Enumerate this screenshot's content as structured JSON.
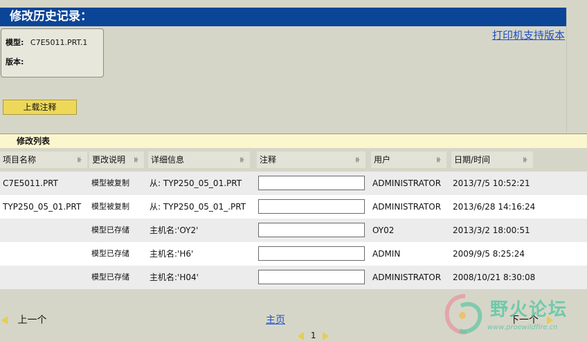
{
  "page_title": "修改历史记录：",
  "print_link": "打印机支持版本",
  "info": {
    "model_label": "模型:",
    "model_value": "C7E5011.PRT.1",
    "version_label": "版本:",
    "version_value": ""
  },
  "upload_button": "上载注释",
  "section_title": "修改列表",
  "columns": [
    "项目名称",
    "更改说明",
    "详细信息",
    "注释",
    "用户",
    "日期/时间"
  ],
  "rows": [
    {
      "name": "C7E5011.PRT",
      "change": "模型被复制",
      "detail": "从: TYP250_05_01.PRT",
      "note": "",
      "user": "ADMINISTRATOR",
      "datetime": "2013/7/5 10:52:21"
    },
    {
      "name": "TYP250_05_01.PRT",
      "change": "模型被复制",
      "detail": "从: TYP250_05_01_.PRT",
      "note": "",
      "user": "ADMINISTRATOR",
      "datetime": "2013/6/28 14:16:24"
    },
    {
      "name": "",
      "change": "模型已存储",
      "detail": "主机名:'OY2'",
      "note": "",
      "user": "OY02",
      "datetime": "2013/3/2 18:00:51"
    },
    {
      "name": "",
      "change": "模型已存储",
      "detail": "主机名:'H6'",
      "note": "",
      "user": "ADMIN",
      "datetime": "2009/9/5 8:25:24"
    },
    {
      "name": "",
      "change": "模型已存储",
      "detail": "主机名:'H04'",
      "note": "",
      "user": "ADMINISTRATOR",
      "datetime": "2008/10/21 8:30:08"
    }
  ],
  "nav": {
    "prev": "上一个",
    "home": "主页",
    "next": "下一个",
    "page": "1"
  },
  "watermark": {
    "title": "野火论坛",
    "url": "www.proewildfire.cn"
  },
  "colors": {
    "title_bar": "#0b4597",
    "background": "#d6d6c8",
    "button": "#eed85a",
    "section_header": "#fcf6cf",
    "link": "#1f4fc4"
  }
}
